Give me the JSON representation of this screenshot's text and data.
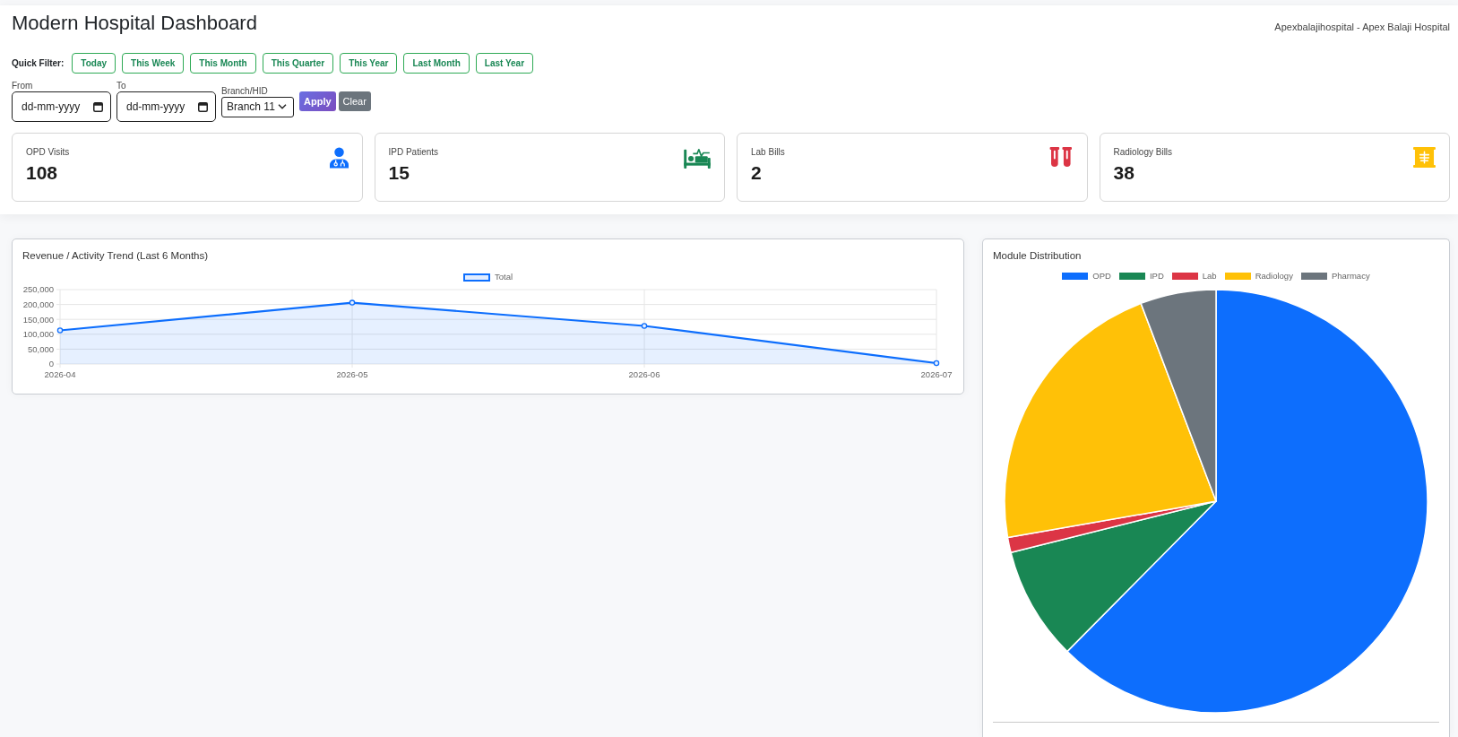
{
  "header": {
    "title": "Modern Hospital Dashboard",
    "hospital": "Apexbalajihospital - Apex Balaji Hospital"
  },
  "quick_filter": {
    "label": "Quick Filter:",
    "options": [
      {
        "label": "Today",
        "selected": false
      },
      {
        "label": "This Week",
        "selected": false
      },
      {
        "label": "This Month",
        "selected": false
      },
      {
        "label": "This Quarter",
        "selected": false
      },
      {
        "label": "This Year",
        "selected": false
      },
      {
        "label": "Last Month",
        "selected": false
      },
      {
        "label": "Last Year",
        "selected": false
      }
    ]
  },
  "filters": {
    "from": {
      "label": "From",
      "placeholder": "dd-mm-yyyy"
    },
    "to": {
      "label": "To",
      "placeholder": "dd-mm-yyyy"
    },
    "branch": {
      "label": "Branch/HID",
      "value": "Branch 11"
    },
    "buttons": [
      {
        "label": "Apply",
        "kind": "primary"
      },
      {
        "label": "Clear",
        "kind": "secondary"
      }
    ]
  },
  "stats": [
    {
      "label": "OPD Visits",
      "value": "108",
      "color": "#0d6efd"
    },
    {
      "label": "IPD Patients",
      "value": "15",
      "color": "#198754"
    },
    {
      "label": "Lab Bills",
      "value": "2",
      "color": "#dc3545"
    },
    {
      "label": "Radiology Bills",
      "value": "38",
      "color": "#ffc107"
    }
  ],
  "trend": {
    "title": "Revenue / Activity Trend (Last 6 Months)",
    "chart_data": {
      "type": "area",
      "categories": [
        "2026-04",
        "2026-05",
        "2026-06",
        "2026-07"
      ],
      "series": [
        {
          "name": "Total",
          "color": "#0d6efd",
          "values": [
            113000,
            206000,
            128000,
            3000
          ]
        }
      ],
      "ylim": [
        0,
        250000
      ],
      "yticks": [
        {
          "value": 0,
          "label": "0"
        },
        {
          "value": 50000,
          "label": "50,000"
        },
        {
          "value": 100000,
          "label": "100,000"
        },
        {
          "value": 150000,
          "label": "150,000"
        },
        {
          "value": 200000,
          "label": "200,000"
        },
        {
          "value": 250000,
          "label": "250,000"
        }
      ],
      "grid": true
    }
  },
  "distribution": {
    "title": "Module Distribution",
    "legend": [
      {
        "label": "OPD",
        "color": "#0d6efd"
      },
      {
        "label": "IPD",
        "color": "#198754"
      },
      {
        "label": "Lab",
        "color": "#dc3545"
      },
      {
        "label": "Radiology",
        "color": "#ffc107"
      },
      {
        "label": "Pharmacy",
        "color": "#6c757d"
      }
    ]
  }
}
